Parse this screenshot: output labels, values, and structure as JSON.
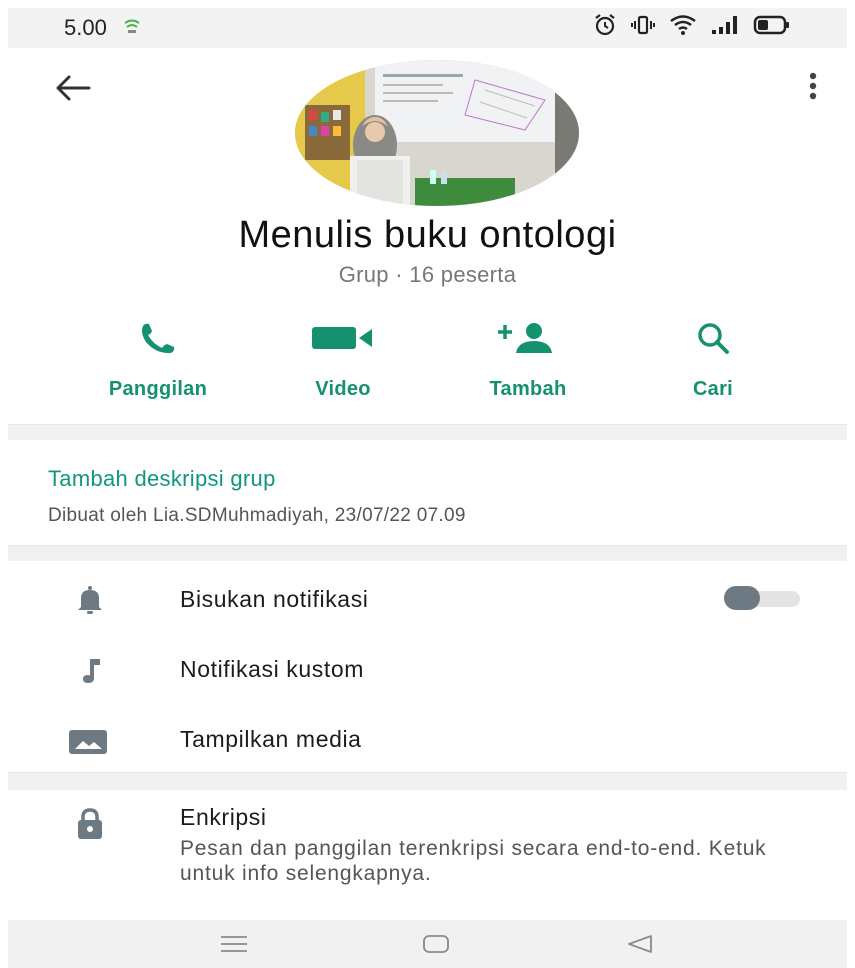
{
  "status_bar": {
    "time": "5.00",
    "icons": [
      "notification-icon",
      "alarm-icon",
      "vibrate-icon",
      "wifi-icon",
      "signal-icon",
      "battery-icon"
    ]
  },
  "header": {
    "back_icon": "arrow-left-icon",
    "menu_icon": "more-vertical-icon"
  },
  "group": {
    "name": "Menulis buku ontologi",
    "subtitle": "Grup · 16 peserta"
  },
  "actions": [
    {
      "label": "Panggilan",
      "icon": "phone-icon"
    },
    {
      "label": "Video",
      "icon": "video-icon"
    },
    {
      "label": "Tambah",
      "icon": "add-person-icon"
    },
    {
      "label": "Cari",
      "icon": "search-icon"
    }
  ],
  "description": {
    "add_label": "Tambah deskripsi grup",
    "created_by": "Dibuat oleh Lia.SDMuhmadiyah, 23/07/22 07.09"
  },
  "settings": {
    "mute": {
      "label": "Bisukan notifikasi",
      "icon": "bell-icon",
      "enabled": false
    },
    "custom": {
      "label": "Notifikasi kustom",
      "icon": "music-note-icon"
    },
    "media": {
      "label": "Tampilkan media",
      "icon": "image-icon"
    }
  },
  "encryption": {
    "title": "Enkripsi",
    "description": "Pesan dan panggilan terenkripsi secara end-to-end. Ketuk untuk info selengkapnya.",
    "icon": "lock-icon"
  },
  "nav": {
    "icons": [
      "recents-icon",
      "home-icon",
      "back-triangle-icon"
    ]
  },
  "colors": {
    "accent": "#14916f",
    "icon_gray": "#6d7a83"
  }
}
